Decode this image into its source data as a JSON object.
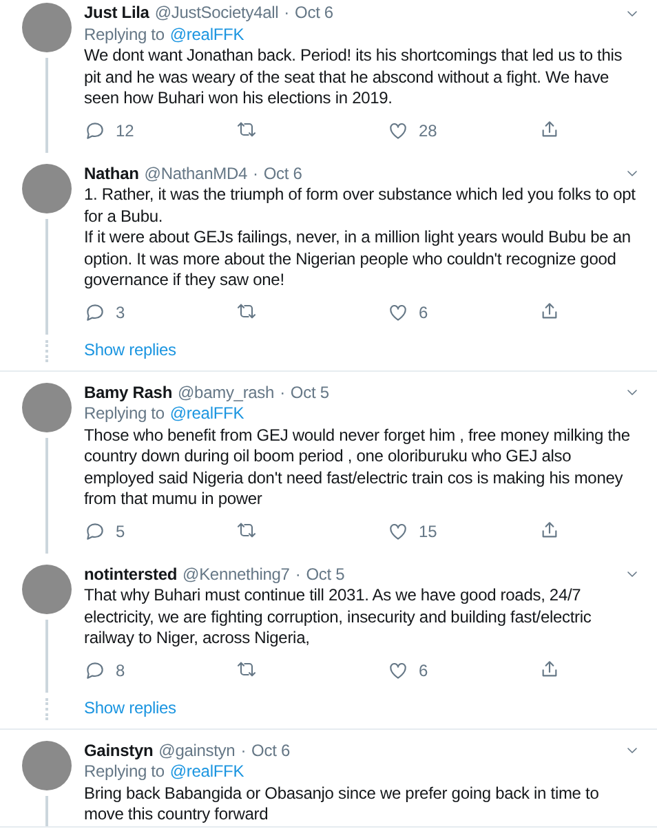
{
  "groups": [
    {
      "tweets": [
        {
          "name": "Just Lila",
          "handle": "@JustSociety4all",
          "separator": "·",
          "date": "Oct 6",
          "replying_label": "Replying to",
          "replying_to": "@realFFK",
          "text": "We dont want Jonathan back. Period! its his shortcomings that led us to this pit and he was weary of the seat that he abscond without a fight. We have seen how Buhari won his elections in 2019.",
          "replies": "12",
          "likes": "28",
          "thread_line": true
        },
        {
          "name": "Nathan",
          "handle": "@NathanMD4",
          "separator": "·",
          "date": "Oct 6",
          "text": "1. Rather, it was the triumph of form over substance which led you folks to opt for a Bubu.\nIf it were about GEJs failings, never, in a million light years would Bubu be an option. It was more about the Nigerian people who couldn't recognize good governance if they saw one!",
          "replies": "3",
          "likes": "6",
          "thread_line": true
        }
      ],
      "show_replies": "Show replies"
    },
    {
      "tweets": [
        {
          "name": "Bamy Rash",
          "handle": "@bamy_rash",
          "separator": "·",
          "date": "Oct 5",
          "replying_label": "Replying to",
          "replying_to": "@realFFK",
          "text": "Those who benefit from GEJ would never forget him , free money milking the country down during oil boom period , one oloriburuku who GEJ also employed said Nigeria don't need fast/electric train cos is making his money from that mumu in power",
          "replies": "5",
          "likes": "15",
          "thread_line": true
        },
        {
          "name": "notintersted",
          "handle": "@Kennething7",
          "separator": "·",
          "date": "Oct 5",
          "text": "That why Buhari must continue till 2031. As we have good roads, 24/7 electricity, we are fighting corruption, insecurity and building fast/electric railway to Niger, across Nigeria,",
          "replies": "8",
          "likes": "6",
          "thread_line": true
        }
      ],
      "show_replies": "Show replies"
    },
    {
      "tweets": [
        {
          "name": "Gainstyn",
          "handle": "@gainstyn",
          "separator": "·",
          "date": "Oct 6",
          "replying_label": "Replying to",
          "replying_to": "@realFFK",
          "text": "Bring back Babangida or Obasanjo since we prefer going back in time to move this country forward",
          "thread_line": true
        }
      ]
    }
  ]
}
